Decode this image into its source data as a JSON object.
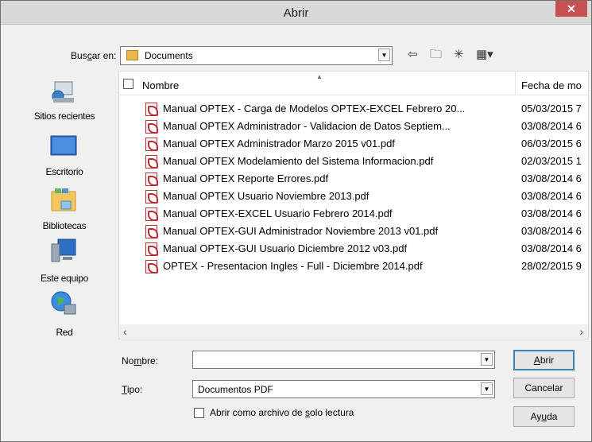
{
  "dialog": {
    "title": "Abrir",
    "close_glyph": "✕"
  },
  "lookin": {
    "label_pre": "Bus",
    "label_u": "c",
    "label_post": "ar en:",
    "value": "Documents"
  },
  "places": [
    {
      "label": "Sitios recientes",
      "icon": "recent-places-icon"
    },
    {
      "label": "Escritorio",
      "icon": "desktop-icon"
    },
    {
      "label": "Bibliotecas",
      "icon": "libraries-icon"
    },
    {
      "label": "Este equipo",
      "icon": "this-pc-icon"
    },
    {
      "label": "Red",
      "icon": "network-icon"
    }
  ],
  "columns": {
    "name": "Nombre",
    "date": "Fecha de mo"
  },
  "files": [
    {
      "name": "Manual OPTEX - Carga de Modelos  OPTEX-EXCEL Febrero 20...",
      "date": "05/03/2015 7"
    },
    {
      "name": "Manual OPTEX Administrador - Validacion de Datos Septiem...",
      "date": "03/08/2014 6"
    },
    {
      "name": "Manual OPTEX Administrador Marzo 2015 v01.pdf",
      "date": "06/03/2015 6"
    },
    {
      "name": "Manual OPTEX Modelamiento del Sistema Informacion.pdf",
      "date": "02/03/2015 1"
    },
    {
      "name": "Manual OPTEX Reporte Errores.pdf",
      "date": "03/08/2014 6"
    },
    {
      "name": "Manual OPTEX Usuario Noviembre 2013.pdf",
      "date": "03/08/2014 6"
    },
    {
      "name": "Manual OPTEX-EXCEL Usuario Febrero 2014.pdf",
      "date": "03/08/2014 6"
    },
    {
      "name": "Manual OPTEX-GUI Administrador Noviembre 2013 v01.pdf",
      "date": "03/08/2014 6"
    },
    {
      "name": "Manual OPTEX-GUI Usuario Diciembre 2012 v03.pdf",
      "date": "03/08/2014 6"
    },
    {
      "name": "OPTEX - Presentacion Ingles - Full - Diciembre 2014.pdf",
      "date": "28/02/2015 9"
    }
  ],
  "form": {
    "name_label_pre": "No",
    "name_label_u": "m",
    "name_label_post": "bre:",
    "name_value": "",
    "type_label_u": "T",
    "type_label_post": "ipo:",
    "type_value": "Documentos PDF",
    "readonly_pre": "Abrir como archivo de ",
    "readonly_u": "s",
    "readonly_post": "olo lectura"
  },
  "buttons": {
    "open_u": "A",
    "open_post": "brir",
    "cancel": "Cancelar",
    "help_pre": "Ay",
    "help_u": "u",
    "help_post": "da"
  },
  "colors": {
    "close_bg": "#c75050",
    "default_button_border": "#3c7fb1"
  }
}
